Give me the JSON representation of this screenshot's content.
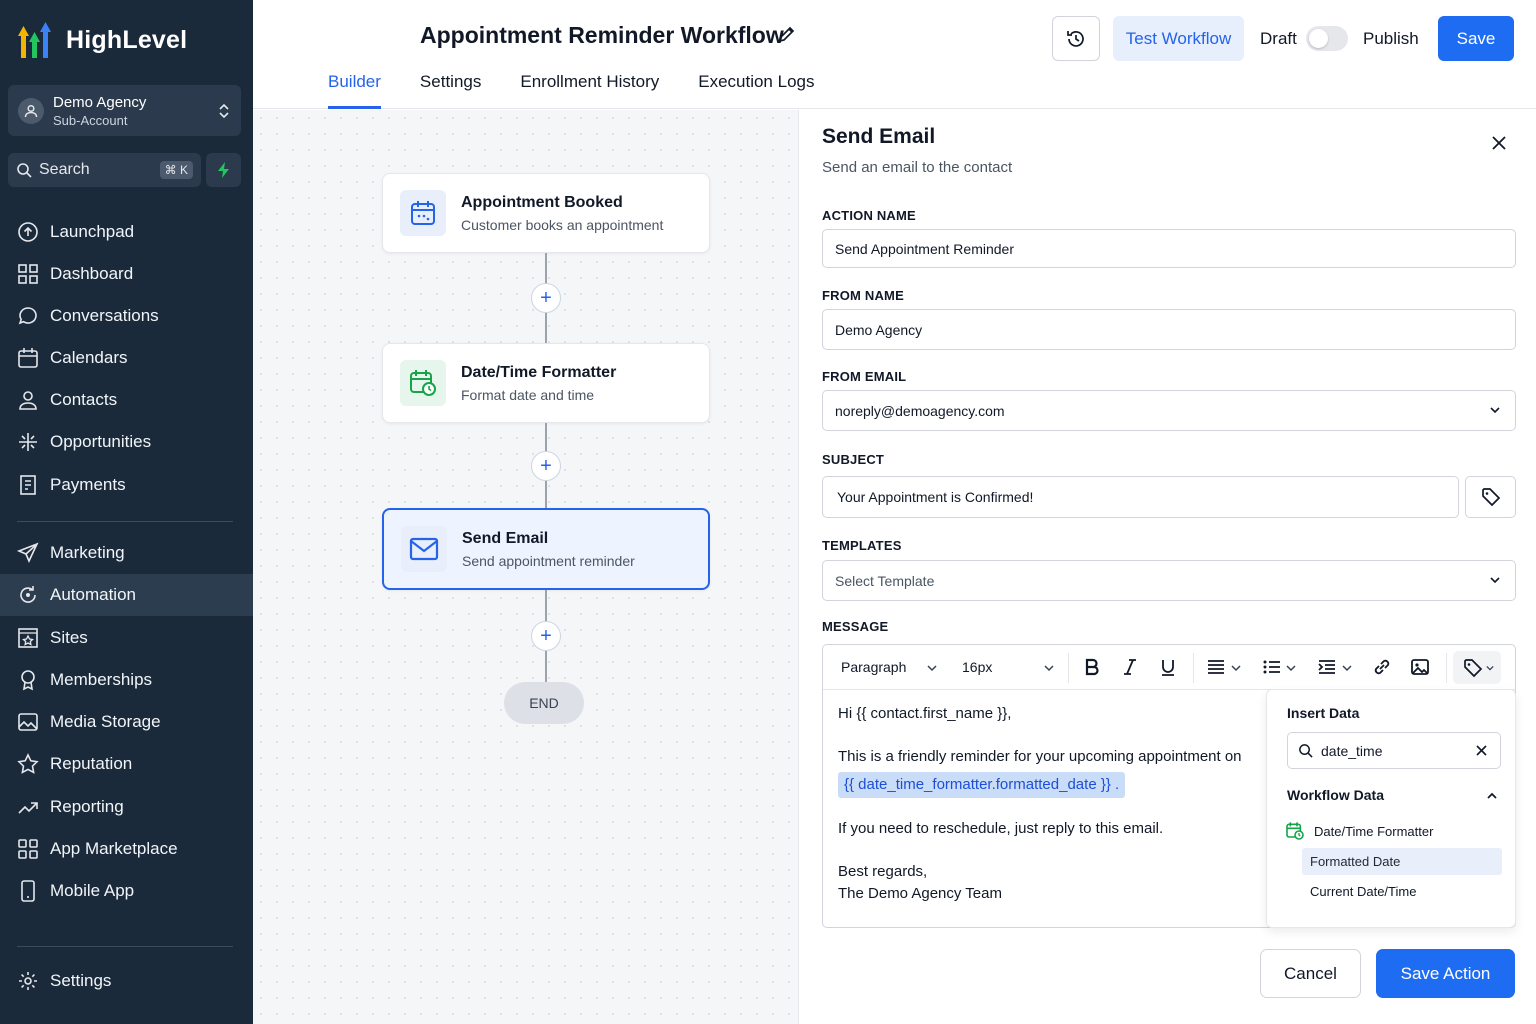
{
  "brand": {
    "name": "HighLevel"
  },
  "account": {
    "name": "Demo Agency",
    "type": "Sub-Account"
  },
  "search": {
    "label": "Search",
    "shortcut": "⌘ K"
  },
  "nav": {
    "items": [
      {
        "label": "Launchpad",
        "icon": "launchpad-icon"
      },
      {
        "label": "Dashboard",
        "icon": "dashboard-icon"
      },
      {
        "label": "Conversations",
        "icon": "chat-icon"
      },
      {
        "label": "Calendars",
        "icon": "calendar-icon"
      },
      {
        "label": "Contacts",
        "icon": "contacts-icon"
      },
      {
        "label": "Opportunities",
        "icon": "opportunities-icon"
      },
      {
        "label": "Payments",
        "icon": "payments-icon"
      },
      {
        "label": "Marketing",
        "icon": "send-icon"
      },
      {
        "label": "Automation",
        "icon": "automation-icon",
        "active": true
      },
      {
        "label": "Sites",
        "icon": "sites-icon"
      },
      {
        "label": "Memberships",
        "icon": "memberships-icon"
      },
      {
        "label": "Media Storage",
        "icon": "media-icon"
      },
      {
        "label": "Reputation",
        "icon": "star-icon"
      },
      {
        "label": "Reporting",
        "icon": "trend-icon"
      },
      {
        "label": "App Marketplace",
        "icon": "apps-icon"
      },
      {
        "label": "Mobile App",
        "icon": "mobile-icon"
      }
    ],
    "settings": "Settings"
  },
  "header": {
    "title": "Appointment Reminder Workflow",
    "tabs": [
      "Builder",
      "Settings",
      "Enrollment History",
      "Execution Logs"
    ],
    "active_tab": "Builder",
    "test_label": "Test Workflow",
    "draft_label": "Draft",
    "publish_label": "Publish",
    "save_label": "Save"
  },
  "workflow": {
    "nodes": [
      {
        "title": "Appointment Booked",
        "subtitle": "Customer books an appointment",
        "icon": "calendar-icon"
      },
      {
        "title": "Date/Time Formatter",
        "subtitle": "Format date and time",
        "icon": "calendar-clock-icon"
      },
      {
        "title": "Send Email",
        "subtitle": "Send appointment reminder",
        "icon": "mail-icon",
        "selected": true
      }
    ],
    "plus": "+",
    "end_label": "END"
  },
  "panel": {
    "title": "Send Email",
    "subtitle": "Send an email to the contact",
    "action_name_label": "ACTION NAME",
    "action_name_value": "Send Appointment Reminder",
    "from_name_label": "FROM NAME",
    "from_name_value": "Demo Agency",
    "from_email_label": "FROM EMAIL",
    "from_email_value": "noreply@demoagency.com",
    "subject_label": "SUBJECT",
    "subject_value": "Your Appointment is Confirmed!",
    "templates_label": "TEMPLATES",
    "templates_placeholder": "Select Template",
    "message_label": "MESSAGE",
    "toolbar": {
      "block": "Paragraph",
      "size": "16px"
    },
    "message": {
      "line1": "Hi {{ contact.first_name }},",
      "line2": "This is a friendly reminder for your upcoming appointment on",
      "variable": "{{ date_time_formatter.formatted_date }}",
      "period": ".",
      "line3": "If you need to reschedule, just reply to this email.",
      "line4": "Best regards,",
      "line5": "The Demo Agency Team"
    },
    "insert_data": {
      "title": "Insert Data",
      "query": "date_time",
      "section": "Workflow Data",
      "group": "Date/Time Formatter",
      "options": [
        "Formatted Date",
        "Current Date/Time"
      ]
    },
    "cancel_label": "Cancel",
    "save_action_label": "Save Action"
  },
  "colors": {
    "accent": "#1d6cf2",
    "sidebar": "#1b2a3b",
    "success": "#16a34a"
  }
}
